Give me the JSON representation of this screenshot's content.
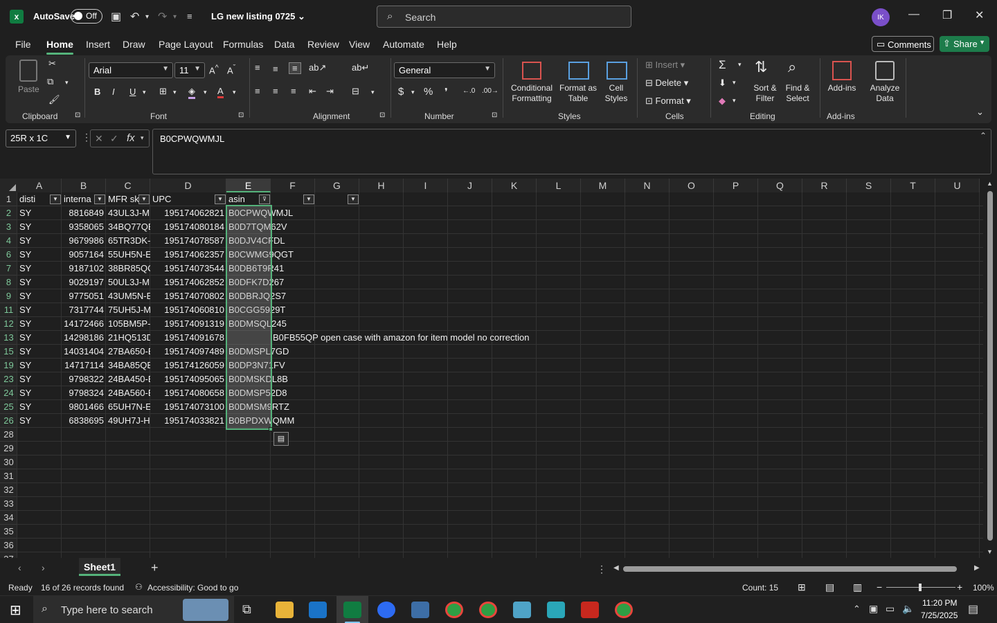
{
  "titlebar": {
    "autosave_label": "AutoSave",
    "autosave_state": "Off",
    "doc_title": "LG new listing 0725",
    "search_placeholder": "Search",
    "avatar_initials": "IK"
  },
  "menu": {
    "tabs": [
      "File",
      "Home",
      "Insert",
      "Draw",
      "Page Layout",
      "Formulas",
      "Data",
      "Review",
      "View",
      "Automate",
      "Help"
    ],
    "active": "Home",
    "comments_label": "Comments",
    "share_label": "Share"
  },
  "ribbon": {
    "clipboard": {
      "label": "Clipboard",
      "paste": "Paste"
    },
    "font": {
      "label": "Font",
      "name": "Arial",
      "size": "11"
    },
    "alignment": {
      "label": "Alignment"
    },
    "number": {
      "label": "Number",
      "format": "General"
    },
    "styles": {
      "label": "Styles",
      "conditional": "Conditional\nFormatting",
      "format_table": "Format as\nTable",
      "cell_styles": "Cell\nStyles"
    },
    "cells": {
      "label": "Cells",
      "insert": "Insert",
      "delete": "Delete",
      "format": "Format"
    },
    "editing": {
      "label": "Editing",
      "sort": "Sort &\nFilter",
      "find": "Find &\nSelect"
    },
    "addins": {
      "label": "Add-ins",
      "addins": "Add-ins",
      "analyze": "Analyze\nData"
    }
  },
  "formula_bar": {
    "name_box": "25R x 1C",
    "fx": "fx",
    "value": "B0CPWQWMJL"
  },
  "grid": {
    "columns": [
      "A",
      "B",
      "C",
      "D",
      "E",
      "F",
      "G",
      "H",
      "I",
      "J",
      "K",
      "L",
      "M",
      "N",
      "O",
      "P",
      "Q",
      "R",
      "S",
      "T",
      "U"
    ],
    "header_row": {
      "row": "1",
      "cells": [
        "disti",
        "interna",
        "MFR sk",
        "UPC",
        "asin"
      ]
    },
    "rows": [
      {
        "row": "2",
        "a": "SY",
        "b": "8816849",
        "c": "43UL3J-M",
        "d": "195174062821",
        "e": "B0CPWQWMJL",
        "f": ""
      },
      {
        "row": "3",
        "a": "SY",
        "b": "9358065",
        "c": "34BQ77QE",
        "d": "195174080184",
        "e": "B0D7TQM62V",
        "f": ""
      },
      {
        "row": "4",
        "a": "SY",
        "b": "9679986",
        "c": "65TR3DK-E",
        "d": "195174078587",
        "e": "B0DJV4CFDL",
        "f": ""
      },
      {
        "row": "6",
        "a": "SY",
        "b": "9057164",
        "c": "55UH5N-E",
        "d": "195174062357",
        "e": "B0CWMG9QGT",
        "f": ""
      },
      {
        "row": "7",
        "a": "SY",
        "b": "9187102",
        "c": "38BR85QC",
        "d": "195174073544",
        "e": "B0DB6T9R41",
        "f": ""
      },
      {
        "row": "8",
        "a": "SY",
        "b": "9029197",
        "c": "50UL3J-M",
        "d": "195174062852",
        "e": "B0DFK7D267",
        "f": ""
      },
      {
        "row": "9",
        "a": "SY",
        "b": "9775051",
        "c": "43UM5N-E",
        "d": "195174070802",
        "e": "B0DBRJQ2S7",
        "f": ""
      },
      {
        "row": "11",
        "a": "SY",
        "b": "7317744",
        "c": "75UH5J-M",
        "d": "195174060810",
        "e": "B0CGG5929T",
        "f": ""
      },
      {
        "row": "12",
        "a": "SY",
        "b": "14172466",
        "c": "105BM5P-",
        "d": "195174091319",
        "e": "B0DMSQL245",
        "f": ""
      },
      {
        "row": "13",
        "a": "SY",
        "b": "14298186",
        "c": "21HQ513D",
        "d": "195174091678",
        "e": "",
        "f": "B0FB55QP open case with amazon for item model no correction"
      },
      {
        "row": "15",
        "a": "SY",
        "b": "14031404",
        "c": "27BA650-E",
        "d": "195174097489",
        "e": "B0DMSPL7GD",
        "f": ""
      },
      {
        "row": "19",
        "a": "SY",
        "b": "14717114",
        "c": "34BA85QE",
        "d": "195174126059",
        "e": "B0DP3N71FV",
        "f": ""
      },
      {
        "row": "23",
        "a": "SY",
        "b": "9798322",
        "c": "24BA450-E",
        "d": "195174095065",
        "e": "B0DMSKDL8B",
        "f": ""
      },
      {
        "row": "24",
        "a": "SY",
        "b": "9798324",
        "c": "24BA560-E",
        "d": "195174080658",
        "e": "B0DMSP52D8",
        "f": ""
      },
      {
        "row": "25",
        "a": "SY",
        "b": "9801466",
        "c": "65UH7N-E",
        "d": "195174073100",
        "e": "B0DMSM9RTZ",
        "f": ""
      },
      {
        "row": "26",
        "a": "SY",
        "b": "6838695",
        "c": "49UH7J-H",
        "d": "195174033821",
        "e": "B0BPDXWQMM",
        "f": ""
      }
    ],
    "empty_rows": [
      "28",
      "29",
      "30",
      "31",
      "32",
      "33",
      "34",
      "35",
      "36",
      "37"
    ]
  },
  "sheets": {
    "tabs": [
      "Sheet1"
    ],
    "active": "Sheet1"
  },
  "status": {
    "ready": "Ready",
    "records": "16 of 26 records found",
    "accessibility": "Accessibility: Good to go",
    "count": "Count: 15",
    "zoom": "100%"
  },
  "taskbar": {
    "search_placeholder": "Type here to search",
    "time": "11:20 PM",
    "date": "7/25/2025"
  },
  "colors": {
    "accent_green": "#55b37b",
    "excel_green": "#107c41",
    "share_green": "#1d7c4b"
  }
}
